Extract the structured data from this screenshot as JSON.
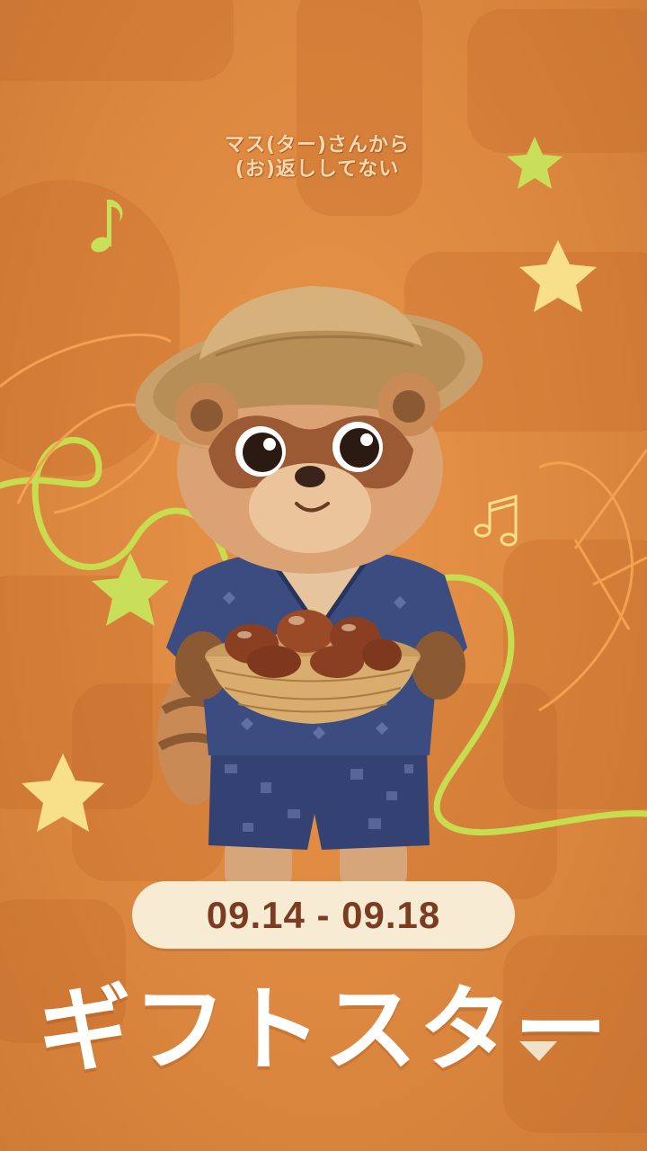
{
  "event": {
    "top_caption": "マス(ター)さんから\n(お)返ししてない",
    "date_range": "09.14 - 09.18",
    "title": "ギフトスター"
  },
  "colors": {
    "background": "#e08a44",
    "pill": "#f7ebd3",
    "date_text": "#7a3d22",
    "title_text": "#ffffff",
    "star_yellow": "#f8e08a",
    "star_green": "#c9df5a",
    "line_green": "#c7dc4f"
  },
  "character": {
    "icon": "tanuki-mascot-icon",
    "holding": "chestnut-basket-icon"
  }
}
